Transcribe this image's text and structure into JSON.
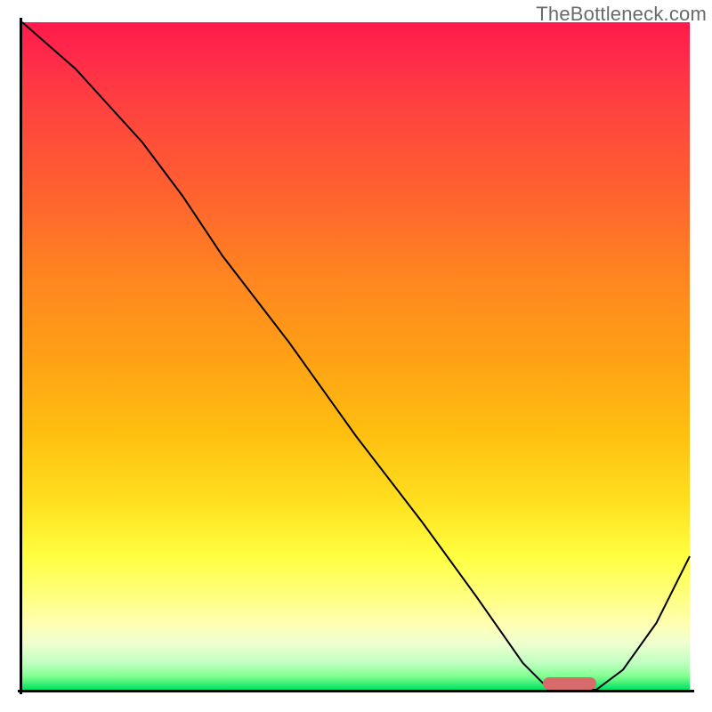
{
  "watermark": "TheBottleneck.com",
  "chart_data": {
    "type": "line",
    "title": "",
    "xlabel": "",
    "ylabel": "",
    "xlim": [
      0,
      100
    ],
    "ylim": [
      0,
      100
    ],
    "grid": false,
    "legend": false,
    "background_gradient": {
      "top_color": "#ff1a4a",
      "mid_color": "#ffe020",
      "bottom_color": "#00e060",
      "meaning": "red=high mismatch, green=optimal"
    },
    "series": [
      {
        "name": "bottleneck-curve",
        "x": [
          0,
          8,
          18,
          24,
          30,
          40,
          50,
          60,
          68,
          75,
          78,
          82,
          86,
          90,
          95,
          100
        ],
        "y": [
          100,
          93,
          82,
          74,
          65,
          52,
          38,
          25,
          14,
          4,
          1,
          0,
          0,
          3,
          10,
          20
        ],
        "stroke": "#000000",
        "stroke_width": 2
      }
    ],
    "annotations": [
      {
        "name": "optimal-range-marker",
        "shape": "rounded-bar",
        "color": "#d76a6a",
        "x_start": 78,
        "x_end": 86,
        "y": 0
      }
    ]
  }
}
